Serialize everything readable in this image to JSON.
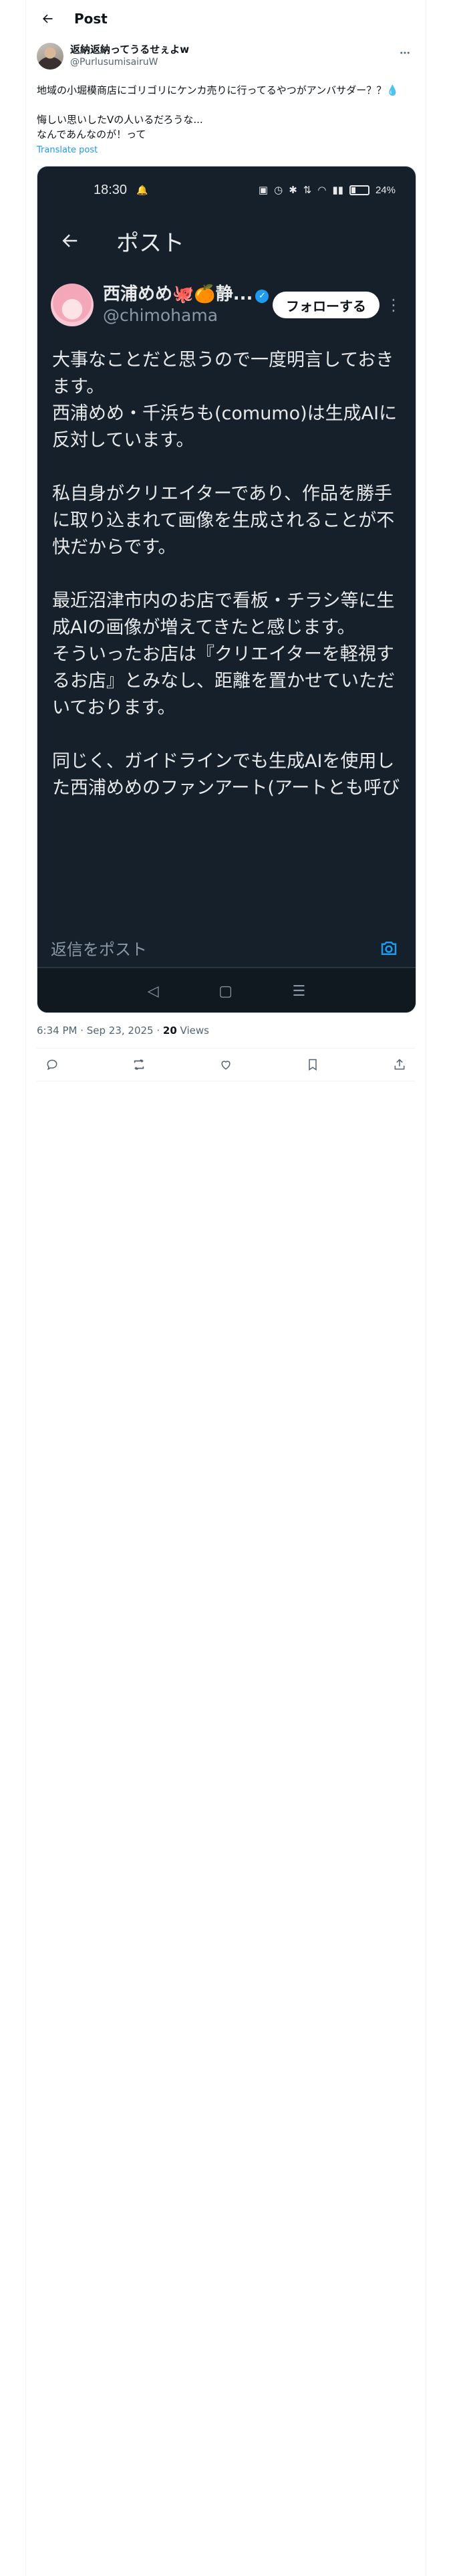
{
  "header": {
    "title": "Post"
  },
  "post": {
    "author_name": "返納返納ってうるせぇよw",
    "author_handle": "@PurlusumisairuW",
    "text": "地域の小堀模商店にゴリゴリにケンカ売りに行ってるやつがアンバサダー？？💧\n\n悔しい思いしたVの人いるだろうな...\nなんであんなのが！って",
    "translate_label": "Translate post",
    "time": "6:34 PM · Sep 23, 2025 · ",
    "views_count": "20",
    "views_label": " Views"
  },
  "screenshot": {
    "status_time": "18:30",
    "battery_label": "24%",
    "battery_level": 0.24,
    "header_title": "ポスト",
    "author_name": "西浦めめ🐙🍊静...",
    "author_handle": "@chimohama",
    "follow_label": "フォローする",
    "paragraphs": [
      "大事なことだと思うので一度明言しておきます。\n西浦めめ・千浜ちも(comumo)は生成AIに反対しています。",
      "私自身がクリエイターであり、作品を勝手に取り込まれて画像を生成されることが不快だからです。",
      "最近沼津市内のお店で看板・チラシ等に生成AIの画像が増えてきたと感じます。\nそういったお店は『クリエイターを軽視するお店』とみなし、距離を置かせていただいております。",
      "同じく、ガイドラインでも生成AIを使用した西浦めめのファンアート(アートとも呼びたくないですが)は禁止しております。\n場合によってはブロック等させていただ"
    ],
    "reply_placeholder": "返信をポスト"
  },
  "colors": {
    "accent": "#1d9bf0",
    "dark_bg": "#15202b",
    "text": "#0f1419",
    "muted": "#536471"
  }
}
